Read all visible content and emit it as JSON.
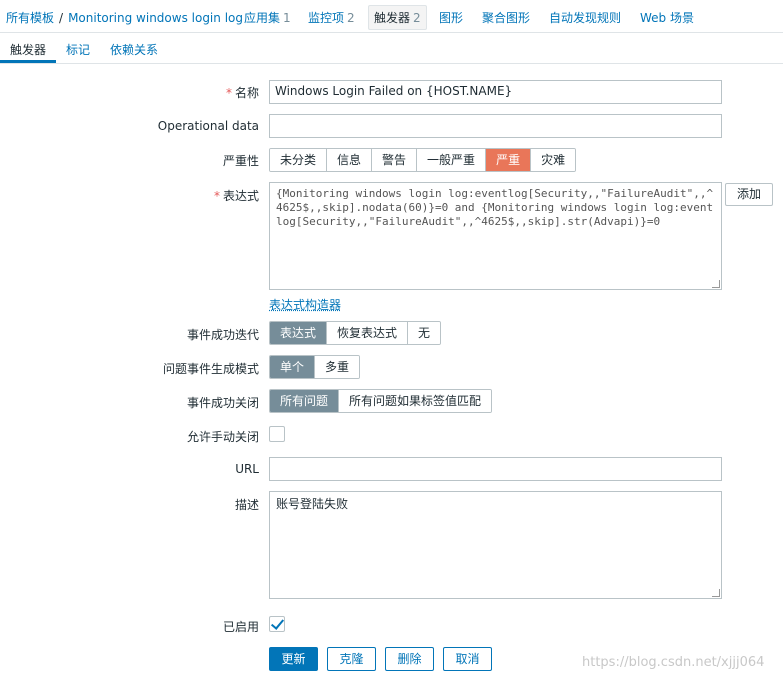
{
  "breadcrumb": {
    "root": "所有模板",
    "separator": "/",
    "template": "Monitoring windows login log"
  },
  "topnav": [
    {
      "label": "应用集",
      "count": "1"
    },
    {
      "label": "监控项",
      "count": "2"
    },
    {
      "label": "触发器",
      "count": "2"
    },
    {
      "label": "图形"
    },
    {
      "label": "聚合图形"
    },
    {
      "label": "自动发现规则"
    },
    {
      "label": "Web 场景"
    }
  ],
  "tabs": [
    "触发器",
    "标记",
    "依赖关系"
  ],
  "form": {
    "name_label": "名称",
    "name_value": "Windows Login Failed on {HOST.NAME}",
    "opdata_label": "Operational data",
    "opdata_value": "",
    "severity_label": "严重性",
    "severity_options": [
      "未分类",
      "信息",
      "警告",
      "一般严重",
      "严重",
      "灾难"
    ],
    "severity_selected": "严重",
    "expression_label": "表达式",
    "expression_value": "{Monitoring windows login log:eventlog[Security,,\"FailureAudit\",,^4625$,,skip].nodata(60)}=0 and {Monitoring windows login log:eventlog[Security,,\"FailureAudit\",,^4625$,,skip].str(Advapi)}=0",
    "add_button": "添加",
    "expression_builder_link": "表达式构造器",
    "ok_event_gen_label": "事件成功迭代",
    "ok_event_gen_options": [
      "表达式",
      "恢复表达式",
      "无"
    ],
    "problem_mode_label": "问题事件生成模式",
    "problem_mode_options": [
      "单个",
      "多重"
    ],
    "ok_close_label": "事件成功关闭",
    "ok_close_options": [
      "所有问题",
      "所有问题如果标签值匹配"
    ],
    "manual_close_label": "允许手动关闭",
    "manual_close_checked": false,
    "url_label": "URL",
    "url_value": "",
    "description_label": "描述",
    "description_value": "账号登陆失败",
    "enabled_label": "已启用",
    "enabled_checked": true
  },
  "buttons": {
    "update": "更新",
    "clone": "克隆",
    "delete": "删除",
    "cancel": "取消"
  },
  "watermark": "https://blog.csdn.net/xjjj064",
  "colors": {
    "link": "#0275b8",
    "severity_high": "#e97659",
    "selected_segment": "#768d99",
    "required": "#e45959"
  }
}
